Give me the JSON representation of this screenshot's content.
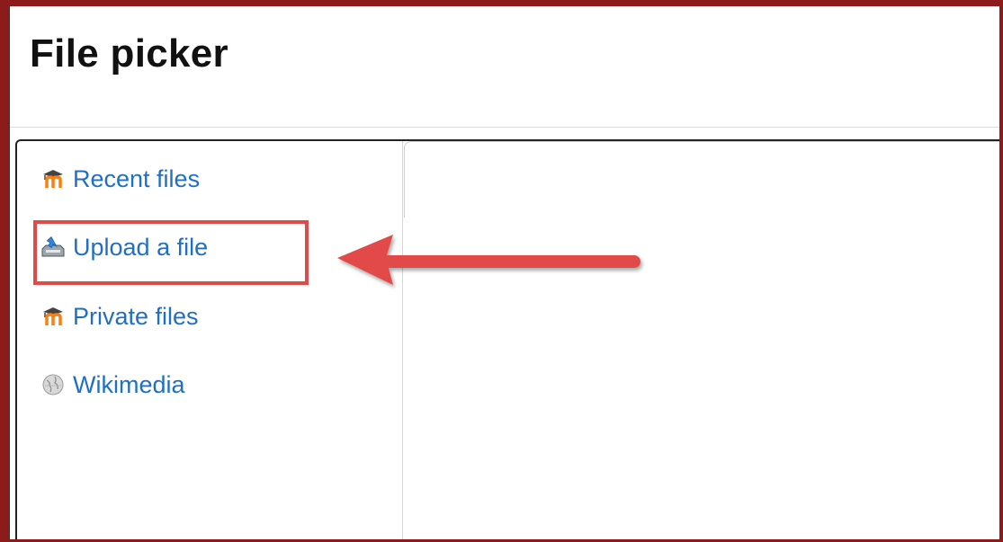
{
  "dialog": {
    "title": "File picker"
  },
  "repositories": [
    {
      "label": "Recent files",
      "icon": "moodle-logo-icon"
    },
    {
      "label": "Upload a file",
      "icon": "upload-icon"
    },
    {
      "label": "Private files",
      "icon": "moodle-logo-icon"
    },
    {
      "label": "Wikimedia",
      "icon": "wikimedia-globe-icon"
    }
  ],
  "annotation": {
    "highlight_color": "#e24a4a",
    "arrow_color": "#e24a4a",
    "points_to": "Upload a file"
  },
  "colors": {
    "link": "#1f6fc4",
    "frame": "#8e1b1b"
  }
}
